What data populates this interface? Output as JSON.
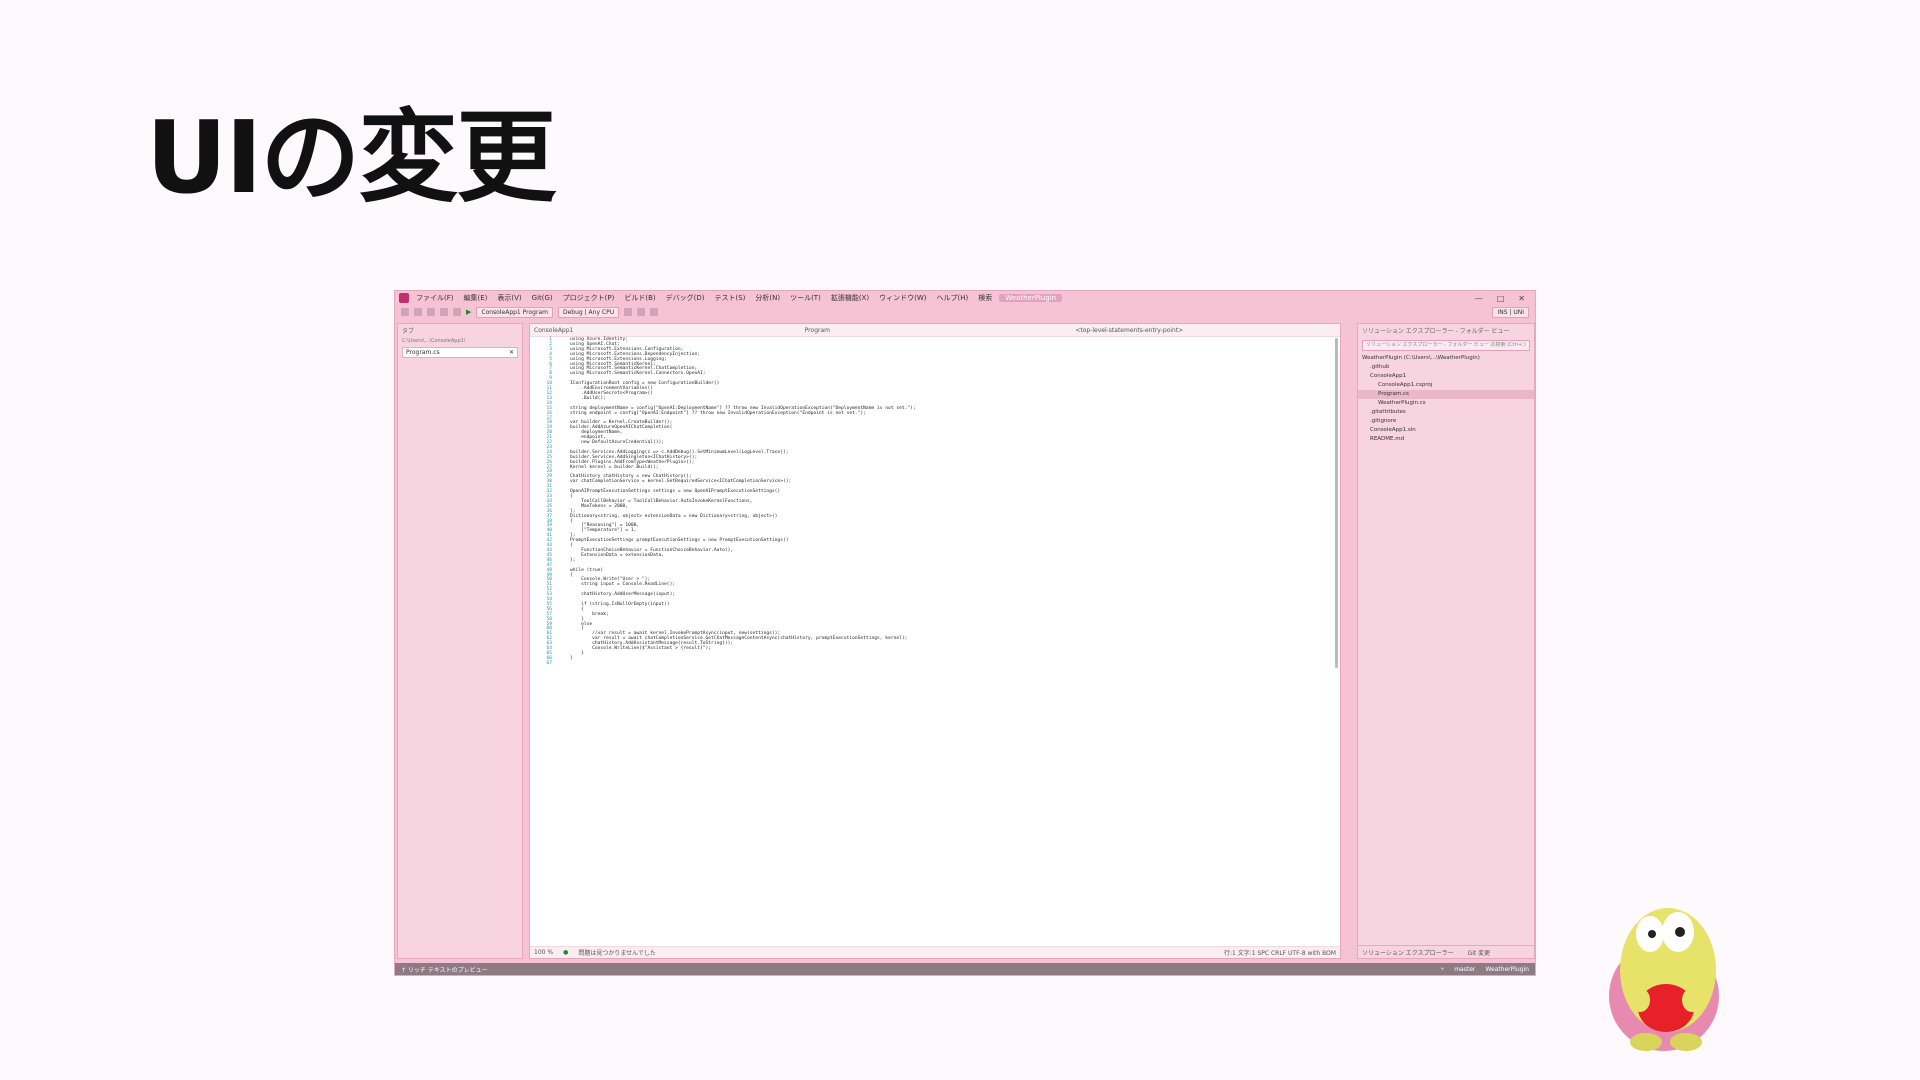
{
  "slide": {
    "title": "UIの変更"
  },
  "menubar": {
    "items": [
      "ファイル(F)",
      "編集(E)",
      "表示(V)",
      "Git(G)",
      "プロジェクト(P)",
      "ビルド(B)",
      "デバッグ(D)",
      "テスト(S)",
      "分析(N)",
      "ツール(T)",
      "拡張機能(X)",
      "ウィンドウ(W)",
      "ヘルプ(H)",
      "検索"
    ],
    "solution_name": "WeatherPlugin",
    "window_controls": [
      "—",
      "□",
      "✕"
    ]
  },
  "toolbar": {
    "project_combo": "ConsoleApp1 Program",
    "config_combo": "Debug | Any CPU",
    "ins_label": "INS | UNI"
  },
  "left_pane": {
    "title": "タブ",
    "path": "C:\\Users\\...\\ConsoleApp1\\",
    "tab_file": "Program.cs"
  },
  "editor": {
    "nav": [
      "ConsoleApp1",
      "Program",
      "<top-level-statements-entry-point>"
    ],
    "zoom": "100 %",
    "issues": "問題は見つかりませんでした",
    "position": "行:1 文字:1 SPC CRLF UTF-8 with BOM"
  },
  "code_lines": [
    "using Azure.Identity;",
    "using OpenAI.Chat;",
    "using Microsoft.Extensions.Configuration;",
    "using Microsoft.Extensions.DependencyInjection;",
    "using Microsoft.Extensions.Logging;",
    "using Microsoft.SemanticKernel;",
    "using Microsoft.SemanticKernel.ChatCompletion;",
    "using Microsoft.SemanticKernel.Connectors.OpenAI;",
    "",
    "IConfigurationRoot config = new ConfigurationBuilder()",
    "    .AddEnvironmentVariables()",
    "    .AddUserSecrets<Program>()",
    "    .Build();",
    "",
    "string deploymentName = config[\"OpenAI:DeploymentName\"] ?? throw new InvalidOperationException(\"DeploymentName is not set.\");",
    "string endpoint = config[\"OpenAI:Endpoint\"] ?? throw new InvalidOperationException(\"Endpoint is not set.\");",
    "",
    "var builder = Kernel.CreateBuilder();",
    "builder.AddAzureOpenAIChatCompletion(",
    "    deploymentName,",
    "    endpoint,",
    "    new DefaultAzureCredential());",
    "",
    "builder.Services.AddLogging(c => c.AddDebug().SetMinimumLevel(LogLevel.Trace));",
    "builder.Services.AddSingleton<IChatHistory>();",
    "builder.Plugins.AddFromType<WeatherPlugin>();",
    "Kernel kernel = builder.Build();",
    "",
    "ChatHistory chatHistory = new ChatHistory();",
    "var chatCompletionService = kernel.GetRequiredService<IChatCompletionService>();",
    "",
    "OpenAIPromptExecutionSettings settings = new OpenAIPromptExecutionSettings()",
    "{",
    "    ToolCallBehavior = ToolCallBehavior.AutoInvokeKernelFunctions,",
    "    MaxTokens = 2000,",
    "};",
    "Dictionary<string, object> extensionData = new Dictionary<string, object>()",
    "{",
    "    [\"Reasoning\"] = 1000,",
    "    [\"Temperature\"] = 1,",
    "};",
    "PromptExecutionSettings promptExecutionSettings = new PromptExecutionSettings()",
    "{",
    "    FunctionChoiceBehavior = FunctionChoiceBehavior.Auto(),",
    "    ExtensionData = extensionData,",
    "};",
    "",
    "while (true)",
    "{",
    "    Console.Write(\"User > \");",
    "    string input = Console.ReadLine();",
    "",
    "    chatHistory.AddUserMessage(input);",
    "",
    "    if (string.IsNullOrEmpty(input))",
    "    {",
    "        break;",
    "    }",
    "    else",
    "    {",
    "        //var result = await kernel.InvokePromptAsync(input, new(settings));",
    "        var result = await chatCompletionService.GetChatMessageContentAsync(chatHistory, promptExecutionSettings, kernel);",
    "        chatHistory.AddAssistantMessage(result.ToString());",
    "        Console.WriteLine($\"Assistant > {result}\");",
    "    }",
    "}",
    ""
  ],
  "right_pane": {
    "title": "ソリューション エクスプローラー - フォルダー ビュー",
    "search_placeholder": "ソリューション エクスプローラー - フォルダー ビュー の検索 (Ctrl+;)",
    "tree": [
      {
        "label": "WeatherPlugin (C:\\Users\\...\\WeatherPlugin)",
        "indent": 0,
        "selected": false
      },
      {
        "label": ".github",
        "indent": 1,
        "selected": false
      },
      {
        "label": "ConsoleApp1",
        "indent": 1,
        "selected": false
      },
      {
        "label": "ConsoleApp1.csproj",
        "indent": 2,
        "selected": false
      },
      {
        "label": "Program.cs",
        "indent": 2,
        "selected": true
      },
      {
        "label": "WeatherPlugin.cs",
        "indent": 2,
        "selected": false
      },
      {
        "label": ".gitattributes",
        "indent": 1,
        "selected": false
      },
      {
        "label": ".gitignore",
        "indent": 1,
        "selected": false
      },
      {
        "label": "ConsoleApp1.sln",
        "indent": 1,
        "selected": false
      },
      {
        "label": "README.md",
        "indent": 1,
        "selected": false
      }
    ],
    "tabs": [
      "ソリューション エクスプローラー",
      "Git 変更"
    ]
  },
  "statusbar": {
    "left": "↑ リッチ テキストのプレビュー",
    "branch": "master",
    "repo": "WeatherPlugin"
  }
}
